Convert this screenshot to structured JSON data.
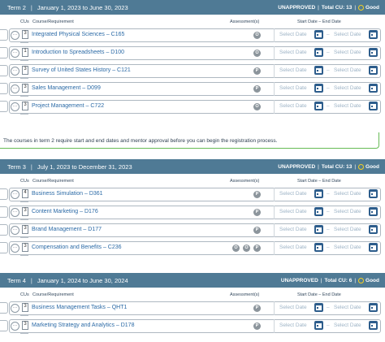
{
  "terms": [
    {
      "name": "Term 2",
      "dates": "January 1, 2023 to June 30, 2023",
      "status": "UNAPPROVED",
      "total_cu": "Total CU: 13",
      "health": "Good",
      "columns": {
        "cus": "CUs",
        "course": "Course/Requirement",
        "assessment": "Assessment(s)",
        "dates": "Start Date – End Date"
      },
      "courses": [
        {
          "cu": "3",
          "name": "Integrated Physical Sciences – C165",
          "icons": [
            "objective-assessment-icon"
          ]
        },
        {
          "cu": "1",
          "name": "Introduction to Spreadsheets – D100",
          "icons": [
            "objective-assessment-icon"
          ]
        },
        {
          "cu": "3",
          "name": "Survey of United States History – C121",
          "icons": [
            "performance-assessment-icon"
          ]
        },
        {
          "cu": "3",
          "name": "Sales Management – D099",
          "icons": [
            "performance-assessment-icon"
          ]
        },
        {
          "cu": "3",
          "name": "Project Management – C722",
          "icons": [
            "objective-assessment-icon"
          ]
        }
      ]
    },
    {
      "name": "Term 3",
      "dates": "July 1, 2023 to December 31, 2023",
      "status": "UNAPPROVED",
      "total_cu": "Total CU: 13",
      "health": "Good",
      "columns": {
        "cus": "CUs",
        "course": "Course/Requirement",
        "assessment": "Assessment(s)",
        "dates": "Start Date – End Date"
      },
      "courses": [
        {
          "cu": "4",
          "name": "Business Simulation – D361",
          "icons": [
            "performance-assessment-icon"
          ]
        },
        {
          "cu": "3",
          "name": "Content Marketing – D176",
          "icons": [
            "performance-assessment-icon"
          ]
        },
        {
          "cu": "3",
          "name": "Brand Management – D177",
          "icons": [
            "performance-assessment-icon"
          ]
        },
        {
          "cu": "3",
          "name": "Compensation and Benefits – C236",
          "icons": [
            "objective-assessment-icon",
            "objective-assessment-icon",
            "performance-assessment-icon"
          ]
        }
      ]
    },
    {
      "name": "Term 4",
      "dates": "January 1, 2024 to June 30, 2024",
      "status": "UNAPPROVED",
      "total_cu": "Total CU: 6",
      "health": "Good",
      "columns": {
        "cus": "CUs",
        "course": "Course/Requirement",
        "assessment": "Assessment(s)",
        "dates": "Start Date – End Date"
      },
      "courses": [
        {
          "cu": "3",
          "name": "Business Management Tasks – QHT1",
          "icons": [
            "performance-assessment-icon"
          ]
        },
        {
          "cu": "3",
          "name": "Marketing Strategy and Analytics – D178",
          "icons": [
            "performance-assessment-icon"
          ]
        }
      ]
    }
  ],
  "date_placeholder": "Select Date",
  "date_separator": "–",
  "more_glyph": "···",
  "objective_glyph": "O",
  "performance_glyph": "P",
  "notice": "The courses in term 2 require start and end dates and mentor approval before you can begin the registration process.",
  "colors": {
    "header": "#4f7a95",
    "link": "#2b6aa6",
    "calendar": "#2d5d8c",
    "placeholder": "#9db3c6",
    "good": "#f5d020",
    "notice_border": "#66bb55"
  }
}
